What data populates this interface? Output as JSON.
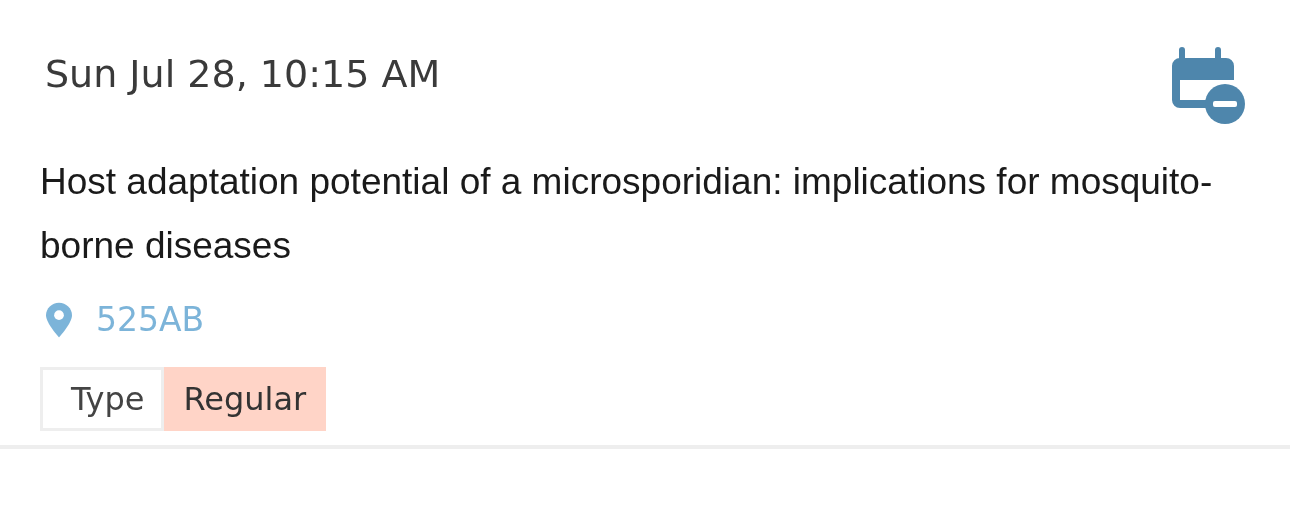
{
  "session": {
    "datetime": "Sun Jul 28, 10:15 AM",
    "title": "Host adaptation potential of a microsporidian: implications for mosquito-borne diseases",
    "location": "525AB",
    "tag": {
      "label": "Type",
      "value": "Regular",
      "color": "#ffd4c7"
    }
  }
}
